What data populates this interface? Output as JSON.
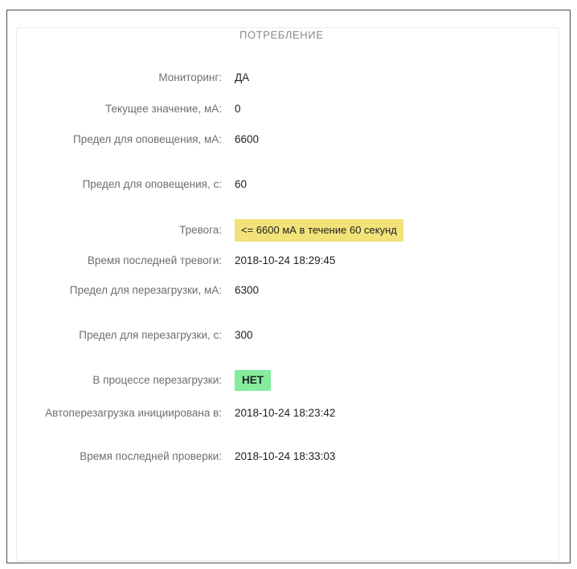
{
  "section": {
    "title": "ПОТРЕБЛЕНИЕ"
  },
  "fields": [
    {
      "label": "Мониторинг:",
      "value": "ДА"
    },
    {
      "label": "Текущее значение, мА:",
      "value": "0"
    },
    {
      "label": "Предел для оповещения, мА:",
      "value": "6600"
    },
    {
      "label": "Предел для оповещения, с:",
      "value": "60"
    },
    {
      "label": "Тревога:",
      "value": "<= 6600 мА в течение 60 секунд",
      "status": "warning",
      "status_color": "#f3e27a"
    },
    {
      "label": "Время последней тревоги:",
      "value": "2018-10-24 18:29:45"
    },
    {
      "label": "Предел для перезагрузки, мА:",
      "value": "6300"
    },
    {
      "label": "Предел для перезагрузки, с:",
      "value": "300"
    },
    {
      "label": "В процессе перезагрузки:",
      "value": "НЕТ",
      "status": "ok",
      "status_color": "#84ec9c"
    },
    {
      "label": "Автоперезагрузка инициирована в:",
      "value": "2018-10-24 18:23:42"
    },
    {
      "label": "Время последней проверки:",
      "value": "2018-10-24 18:33:03"
    }
  ]
}
